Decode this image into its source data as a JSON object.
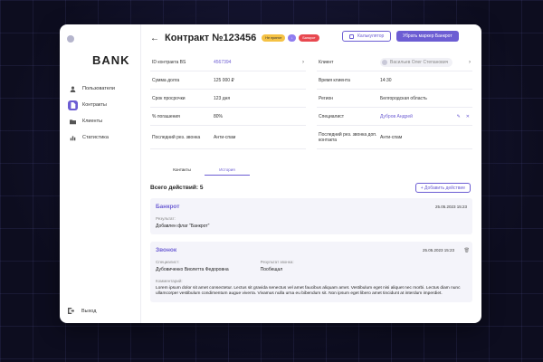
{
  "brand": {
    "logo": "BANK"
  },
  "sidebar": {
    "items": [
      {
        "label": "Пользователи",
        "icon": "user-icon",
        "active": false
      },
      {
        "label": "Контракты",
        "icon": "document-icon",
        "active": true
      },
      {
        "label": "Клиенты",
        "icon": "folder-icon",
        "active": false
      },
      {
        "label": "Статистика",
        "icon": "chart-icon",
        "active": false
      }
    ],
    "logout": "Выход"
  },
  "header": {
    "title": "Контракт №123456",
    "badges": [
      "Не принят",
      "",
      "Банкрот"
    ],
    "calc_button": "Калькулятор",
    "remove_button": "Убрать маркер Банкрот"
  },
  "details_left": [
    {
      "label": "ID контракта BS",
      "value": "4567394",
      "link": true
    },
    {
      "label": "Сумма долга",
      "value": "125 000 ₽"
    },
    {
      "label": "Срок просрочки",
      "value": "123 дня"
    },
    {
      "label": "% погашения",
      "value": "80%"
    },
    {
      "label": "Последний рез. звонка",
      "value": "Анти-спам"
    }
  ],
  "details_right": {
    "client_label": "Клиент",
    "client_value": "Васильев Олег Степанович",
    "time_label": "Время клиента",
    "time_value": "14:30",
    "region_label": "Регион",
    "region_value": "Белгородская область",
    "specialist_label": "Специалист",
    "specialist_value": "Дубров Андрей",
    "last_label": "Последний рез. звонка доп. контакта",
    "last_value": "Анти-спам"
  },
  "tabs": [
    "Контакты",
    "История"
  ],
  "history": {
    "total_label": "Всего действий: 5",
    "add_button": "+ Добавить действие",
    "cards": [
      {
        "title": "Банкрот",
        "date": "25.05.2023 15:23",
        "result_label": "Результат:",
        "result_value": "Добавлен флаг \"Банкрот\""
      },
      {
        "title": "Звонок",
        "date": "25.05.2023 15:23",
        "specialist_label": "Специалист:",
        "specialist_value": "Дубовиченко Виолетта Федоровна",
        "call_label": "Результат звонка:",
        "call_value": "Пообещал",
        "comment_label": "Комментарий:",
        "comment_value": "Lorem ipsum dolor sit amet consectetur. Lectus sit gravida senectus vel amet faucibus aliquam amet. Vestibulum eget nisi aliquet nec morbi. Lectus diam nunc ullamcorper vestibulum condimentum augue viverra. Vivamus nulla urna eu bibendum sit. Non ipsum eget libero amet tincidunt at interdum imperdiet."
      }
    ]
  },
  "colors": {
    "accent": "#6c5dd3",
    "danger": "#e8484f",
    "warning": "#f5c244"
  }
}
